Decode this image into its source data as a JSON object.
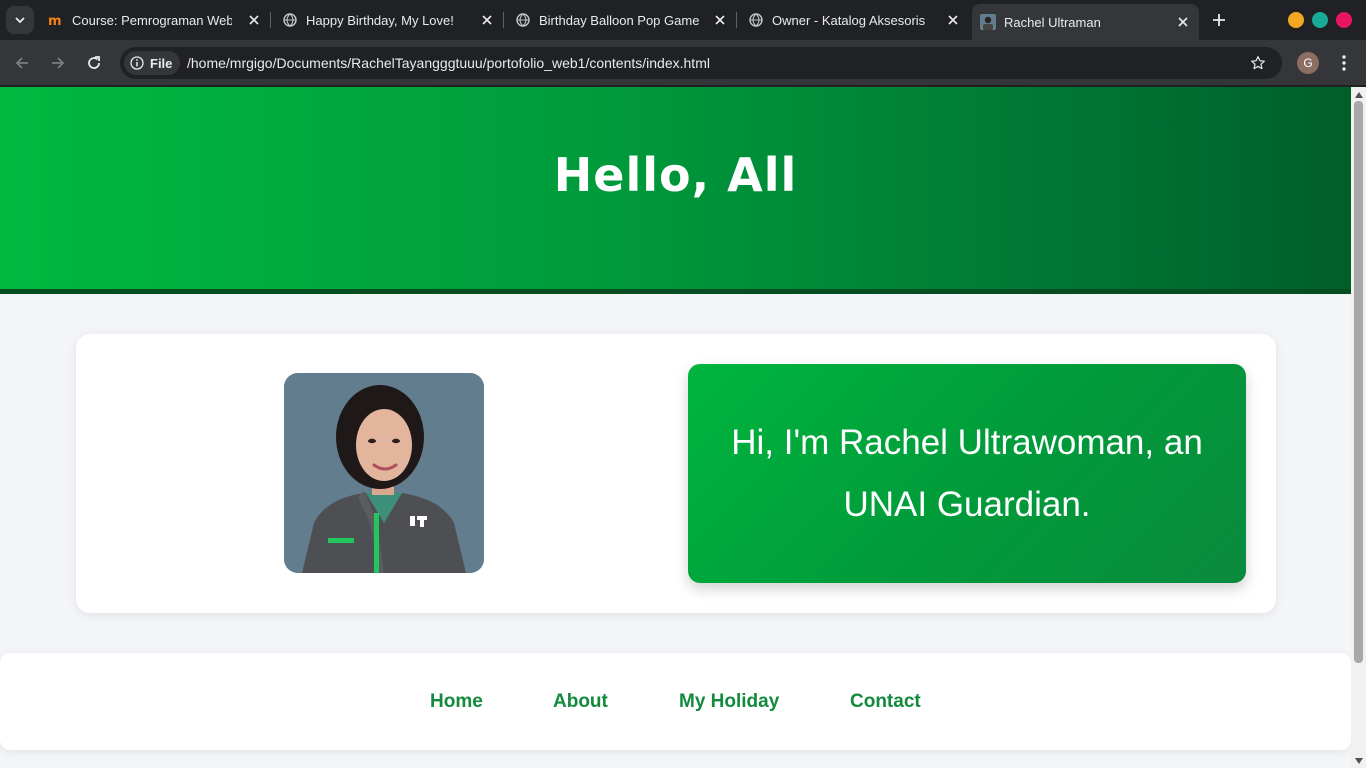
{
  "browser": {
    "tabs": [
      {
        "title": "Course: Pemrograman Web",
        "icon": "moodle-icon",
        "active": false
      },
      {
        "title": "Happy Birthday, My Love!",
        "icon": "globe-icon",
        "active": false
      },
      {
        "title": "Birthday Balloon Pop Game",
        "icon": "globe-icon",
        "active": false
      },
      {
        "title": "Owner - Katalog Aksesoris",
        "icon": "globe-icon",
        "active": false
      },
      {
        "title": "Rachel Ultraman",
        "icon": "profile-thumbnail-icon",
        "active": true
      }
    ],
    "site_chip": "File",
    "url": "/home/mrgigo/Documents/RachelTayangggtuuu/portofolio_web1/contents/index.html",
    "profile_initial": "G",
    "window_buttons": {
      "minimize": "#f5a623",
      "maximize": "#18a999",
      "close": "#e8175d"
    }
  },
  "page": {
    "hero_title": "Hello, All",
    "bio_text": "Hi, I'm Rachel Ultrawoman, an UNAI Guardian.",
    "nav": [
      {
        "label": "Home"
      },
      {
        "label": "About"
      },
      {
        "label": "My Holiday"
      },
      {
        "label": "Contact"
      }
    ],
    "colors": {
      "accent": "#00b93f",
      "accent_dark": "#005f29",
      "nav_link": "#138a3d",
      "page_bg": "#f3f5f9"
    }
  }
}
